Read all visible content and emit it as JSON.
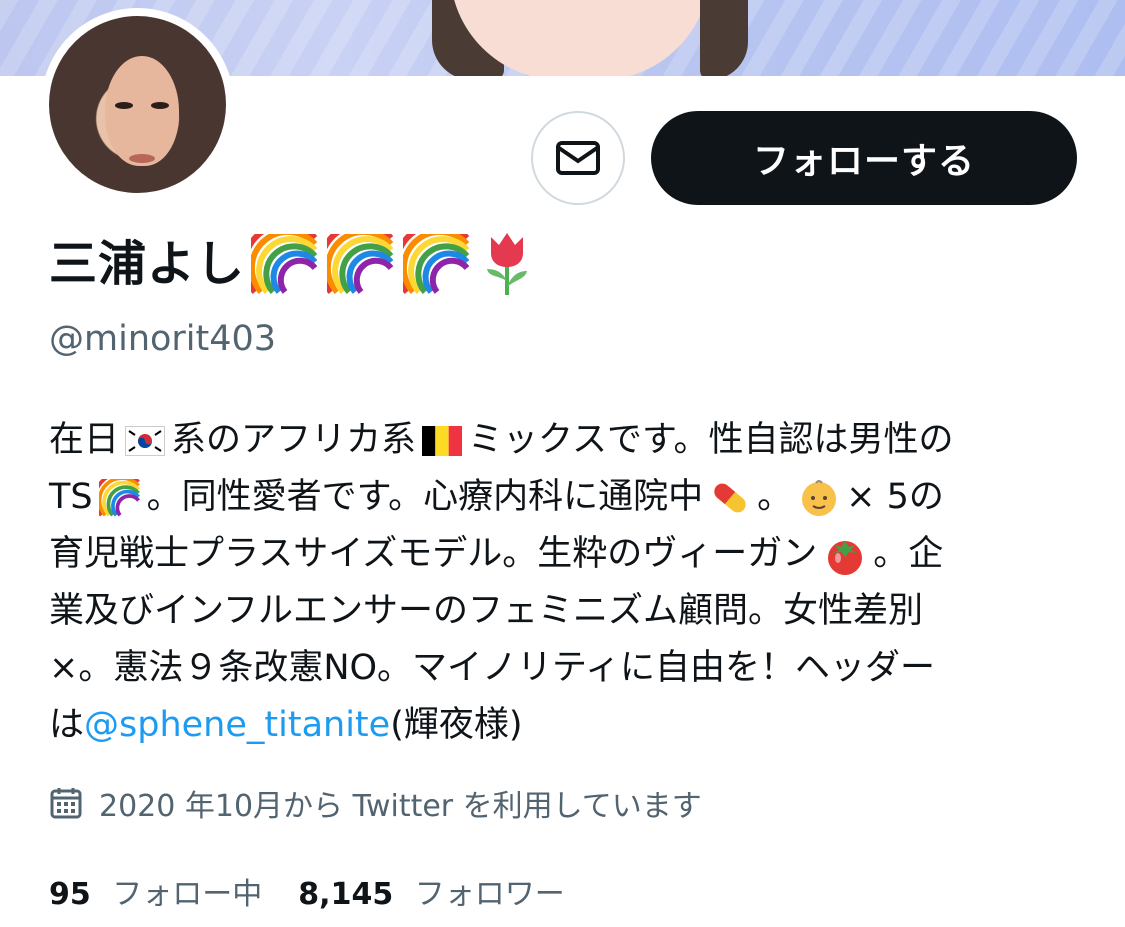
{
  "profile": {
    "name": "三浦よし",
    "name_emojis": [
      "rainbow",
      "rainbow",
      "rainbow",
      "tulip"
    ],
    "handle": "@minorit403",
    "bio": {
      "line1": {
        "a": "在日",
        "b": "系のアフリカ系",
        "c": "ミックスです。性自認は男性の"
      },
      "line2": {
        "a": "TS",
        "b": "。同性愛者です。心療内科に通院中",
        "c": "。",
        "d": "× 5の"
      },
      "line3": {
        "a": "育児戦士プラスサイズモデル。生粋のヴィーガン",
        "b": "。企"
      },
      "line4": "業及びインフルエンサーのフェミニズム顧問。女性差別",
      "line5": "×。憲法９条改憲NO。マイノリティに自由を！ヘッダー",
      "line6": {
        "a": "は",
        "link": "@sphene_titanite",
        "b": "(輝夜様)"
      }
    },
    "joined": "2020 年10月から Twitter を利用しています",
    "following_count": "95",
    "following_label": "フォロー中",
    "followers_count": "8,145",
    "followers_label": "フォロワー"
  },
  "actions": {
    "message_icon": "mail-icon",
    "follow_label": "フォローする"
  },
  "colors": {
    "text": "#0f1419",
    "secondary": "#536471",
    "link": "#1d9bf0",
    "follow_bg": "#0f1419"
  }
}
